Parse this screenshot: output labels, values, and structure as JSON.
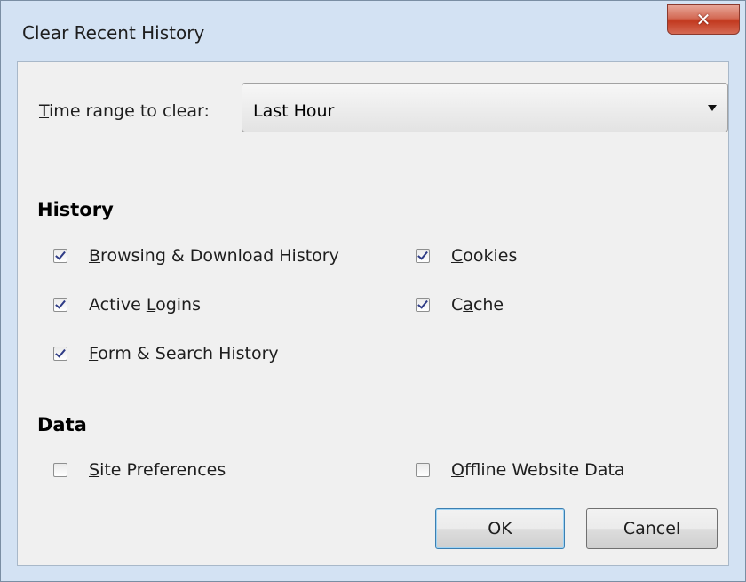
{
  "window": {
    "title": "Clear Recent History",
    "close_glyph": "✕"
  },
  "time_range": {
    "label_first": "T",
    "label_rest": "ime range to clear:",
    "selected": "Last Hour"
  },
  "history": {
    "heading": "History",
    "items": [
      {
        "pre": "",
        "ul": "B",
        "post": "rowsing & Download History",
        "checked": true
      },
      {
        "pre": "",
        "ul": "C",
        "post": "ookies",
        "checked": true
      },
      {
        "pre": "Active ",
        "ul": "L",
        "post": "ogins",
        "checked": true
      },
      {
        "pre": "C",
        "ul": "a",
        "post": "che",
        "checked": true
      },
      {
        "pre": "",
        "ul": "F",
        "post": "orm & Search History",
        "checked": true
      }
    ]
  },
  "data": {
    "heading": "Data",
    "items": [
      {
        "pre": "",
        "ul": "S",
        "post": "ite Preferences",
        "checked": false
      },
      {
        "pre": "",
        "ul": "O",
        "post": "ffline Website Data",
        "checked": false
      }
    ]
  },
  "buttons": {
    "ok": "OK",
    "cancel": "Cancel"
  }
}
